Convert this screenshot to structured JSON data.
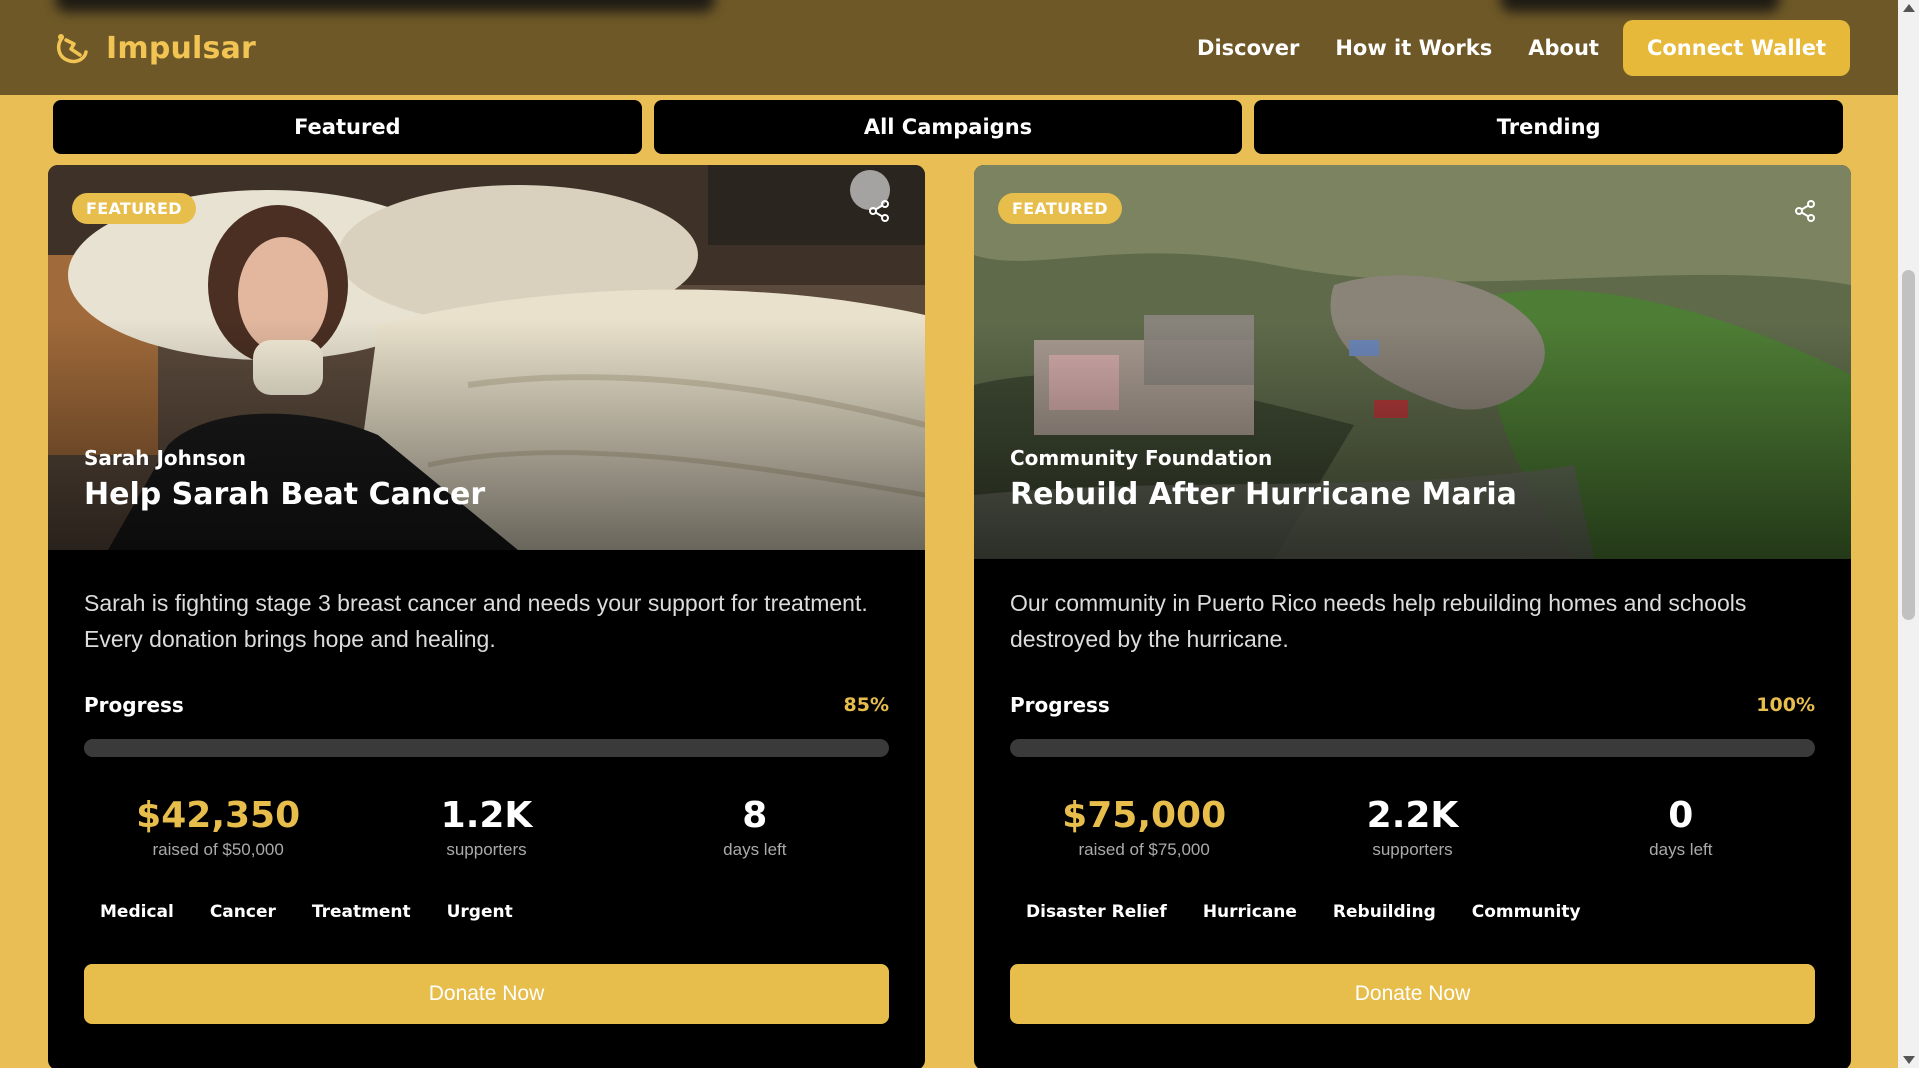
{
  "brand": {
    "name": "Impulsar"
  },
  "nav": {
    "discover": "Discover",
    "how_it_works": "How it Works",
    "about": "About",
    "connect_wallet": "Connect Wallet"
  },
  "tabs": [
    {
      "label": "Featured"
    },
    {
      "label": "All Campaigns"
    },
    {
      "label": "Trending"
    }
  ],
  "campaigns": [
    {
      "badge": "FEATURED",
      "owner": "Sarah Johnson",
      "title": "Help Sarah Beat Cancer",
      "description": "Sarah is fighting stage 3 breast cancer and needs your support for treatment. Every donation brings hope and healing.",
      "progress_label": "Progress",
      "progress_pct": "85%",
      "progress_value": 85,
      "raised": "$42,350",
      "raised_sub": "raised of $50,000",
      "supporters": "1.2K",
      "supporters_sub": "supporters",
      "days": "8",
      "days_sub": "days left",
      "tags": [
        "Medical",
        "Cancer",
        "Treatment",
        "Urgent"
      ],
      "donate_label": "Donate Now"
    },
    {
      "badge": "FEATURED",
      "owner": "Community Foundation",
      "title": "Rebuild After Hurricane Maria",
      "description": "Our community in Puerto Rico needs help rebuilding homes and schools destroyed by the hurricane.",
      "progress_label": "Progress",
      "progress_pct": "100%",
      "progress_value": 100,
      "raised": "$75,000",
      "raised_sub": "raised of $75,000",
      "supporters": "2.2K",
      "supporters_sub": "supporters",
      "days": "0",
      "days_sub": "days left",
      "tags": [
        "Disaster Relief",
        "Hurricane",
        "Rebuilding",
        "Community"
      ],
      "donate_label": "Donate Now"
    }
  ],
  "colors": {
    "page_bg": "#e9bf55",
    "header_bg": "#6e5827",
    "accent": "#e7bd4c",
    "card_bg": "#000000"
  }
}
